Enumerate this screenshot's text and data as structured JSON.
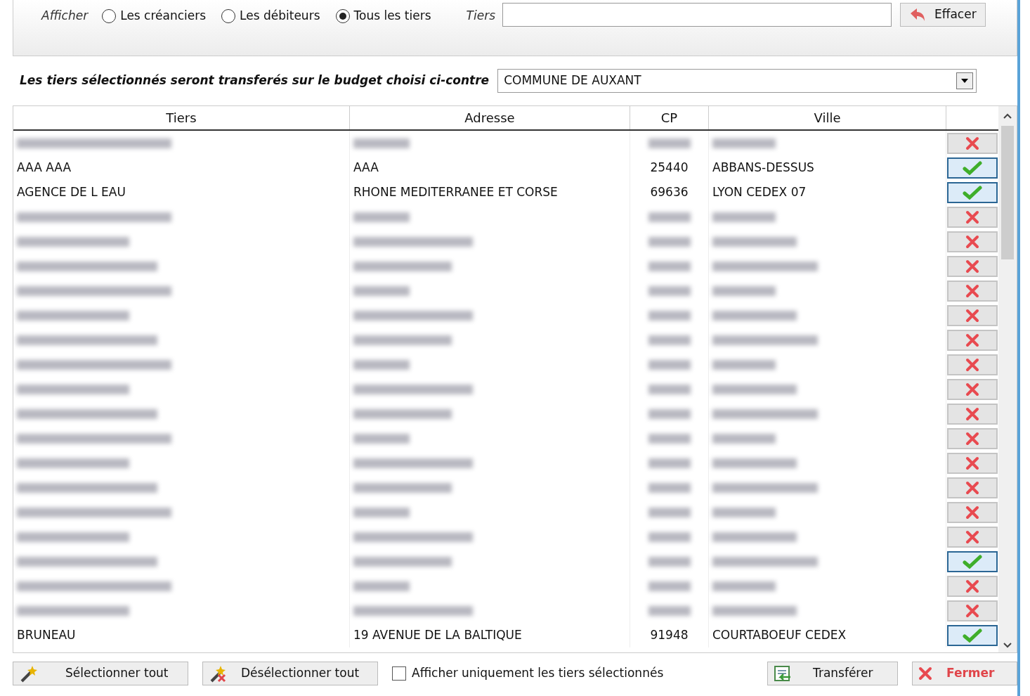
{
  "filter": {
    "label": "Afficher",
    "options": [
      {
        "label": "Les créanciers",
        "selected": false
      },
      {
        "label": "Les débiteurs",
        "selected": false
      },
      {
        "label": "Tous les tiers",
        "selected": true
      }
    ],
    "tiers_label": "Tiers",
    "clear_button": "Effacer"
  },
  "budget": {
    "label": "Les tiers sélectionnés seront transferés sur le budget choisi ci-contre",
    "value": "COMMUNE DE AUXANT"
  },
  "table": {
    "columns": [
      "Tiers",
      "Adresse",
      "CP",
      "Ville"
    ],
    "rows": [
      {
        "kind": "blurred",
        "selected": false
      },
      {
        "kind": "plain",
        "tiers": "AAA AAA",
        "adresse": "AAA",
        "cp": "25440",
        "ville": "ABBANS-DESSUS",
        "selected": true
      },
      {
        "kind": "plain",
        "tiers": "AGENCE DE L EAU",
        "adresse": "RHONE MEDITERRANEE ET CORSE",
        "cp": "69636",
        "ville": "LYON CEDEX 07",
        "selected": true
      },
      {
        "kind": "blurred",
        "selected": false
      },
      {
        "kind": "blurred",
        "selected": false
      },
      {
        "kind": "blurred",
        "selected": false
      },
      {
        "kind": "blurred",
        "selected": false
      },
      {
        "kind": "blurred",
        "selected": false
      },
      {
        "kind": "blurred",
        "selected": false
      },
      {
        "kind": "blurred",
        "selected": false
      },
      {
        "kind": "blurred",
        "selected": false
      },
      {
        "kind": "blurred",
        "selected": false
      },
      {
        "kind": "blurred",
        "selected": false
      },
      {
        "kind": "blurred",
        "selected": false
      },
      {
        "kind": "blurred",
        "selected": false
      },
      {
        "kind": "blurred",
        "selected": false
      },
      {
        "kind": "blurred",
        "selected": false
      },
      {
        "kind": "blurred",
        "selected": true
      },
      {
        "kind": "blurred",
        "selected": false
      },
      {
        "kind": "blurred",
        "selected": false
      },
      {
        "kind": "plain",
        "tiers": "BRUNEAU",
        "adresse": "19 AVENUE DE LA BALTIQUE",
        "cp": "91948",
        "ville": "COURTABOEUF CEDEX",
        "selected": true
      }
    ]
  },
  "footer": {
    "select_all": "Sélectionner tout",
    "deselect_all": "Désélectionner tout",
    "only_selected": {
      "label": "Afficher uniquement les tiers sélectionnés",
      "checked": false
    },
    "transfer": "Transférer",
    "close": "Fermer"
  }
}
